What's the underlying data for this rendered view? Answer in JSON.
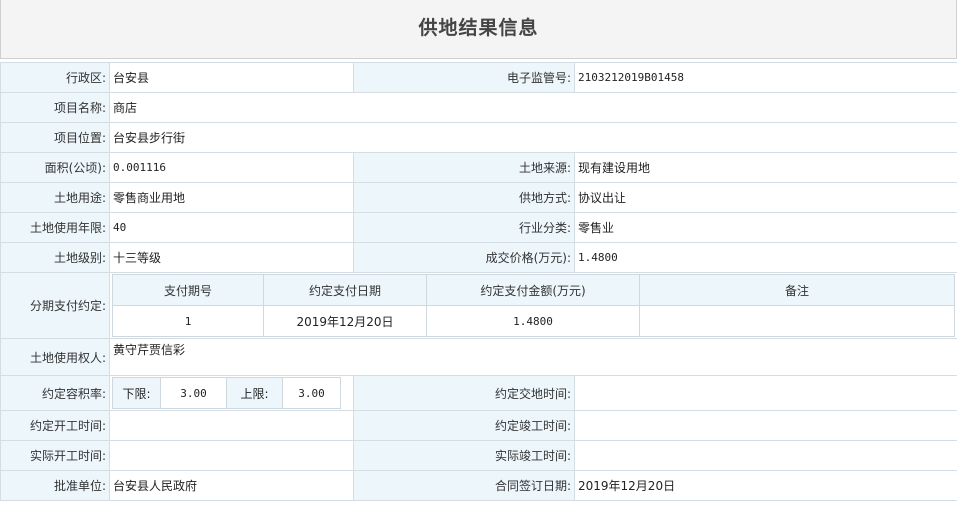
{
  "title": "供地结果信息",
  "labels": {
    "district": "行政区:",
    "supervision_no": "电子监管号:",
    "project_name": "项目名称:",
    "project_location": "项目位置:",
    "area": "面积(公顷):",
    "land_source": "土地来源:",
    "land_use": "土地用途:",
    "supply_method": "供地方式:",
    "use_term": "土地使用年限:",
    "industry": "行业分类:",
    "land_grade": "土地级别:",
    "price": "成交价格(万元):",
    "installments": "分期支付约定:",
    "holder": "土地使用权人:",
    "plot_ratio": "约定容积率:",
    "delivery_time": "约定交地时间:",
    "start_time": "约定开工时间:",
    "finish_time": "约定竣工时间:",
    "actual_start": "实际开工时间:",
    "actual_finish": "实际竣工时间:",
    "approval_unit": "批准单位:",
    "contract_date": "合同签订日期:"
  },
  "values": {
    "district": "台安县",
    "supervision_no": "2103212019B01458",
    "project_name": "商店",
    "project_location": "台安县步行街",
    "area": "0.001116",
    "land_source": "现有建设用地",
    "land_use": "零售商业用地",
    "supply_method": "协议出让",
    "use_term": "40",
    "industry": "零售业",
    "land_grade": "十三等级",
    "price": "1.4800",
    "holder": "黄守芹贾信彩",
    "delivery_time": "",
    "start_time": "",
    "finish_time": "",
    "actual_start": "",
    "actual_finish": "",
    "approval_unit": "台安县人民政府",
    "contract_date": "2019年12月20日"
  },
  "installments": {
    "headers": [
      "支付期号",
      "约定支付日期",
      "约定支付金额(万元)",
      "备注"
    ],
    "rows": [
      [
        "1",
        "2019年12月20日",
        "1.4800",
        ""
      ]
    ]
  },
  "plot_ratio": {
    "lower_label": "下限:",
    "lower_value": "3.00",
    "upper_label": "上限:",
    "upper_value": "3.00"
  }
}
